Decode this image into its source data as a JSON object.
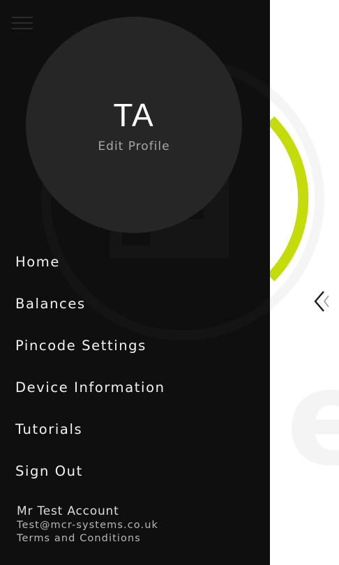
{
  "profile": {
    "initials": "TA",
    "edit_label": "Edit Profile"
  },
  "nav": {
    "items": [
      {
        "label": "Home"
      },
      {
        "label": "Balances"
      },
      {
        "label": "Pincode Settings"
      },
      {
        "label": "Device Information"
      },
      {
        "label": "Tutorials"
      },
      {
        "label": "Sign Out"
      }
    ]
  },
  "account": {
    "name": "Mr Test Account",
    "email": "Test@mcr-systems.co.uk",
    "terms_label": "Terms and Conditions"
  },
  "background": {
    "watermark_text": "es",
    "ring_progress_color": "#c5dc0b",
    "chevron_icon": "chevron-left-icon"
  },
  "colors": {
    "drawer": "#0f0f0f",
    "profile_circle": "#262626",
    "accent": "#c5dc0b"
  },
  "icons": {
    "menu": "hamburger-menu-icon",
    "next": "chevron-left-icon"
  }
}
